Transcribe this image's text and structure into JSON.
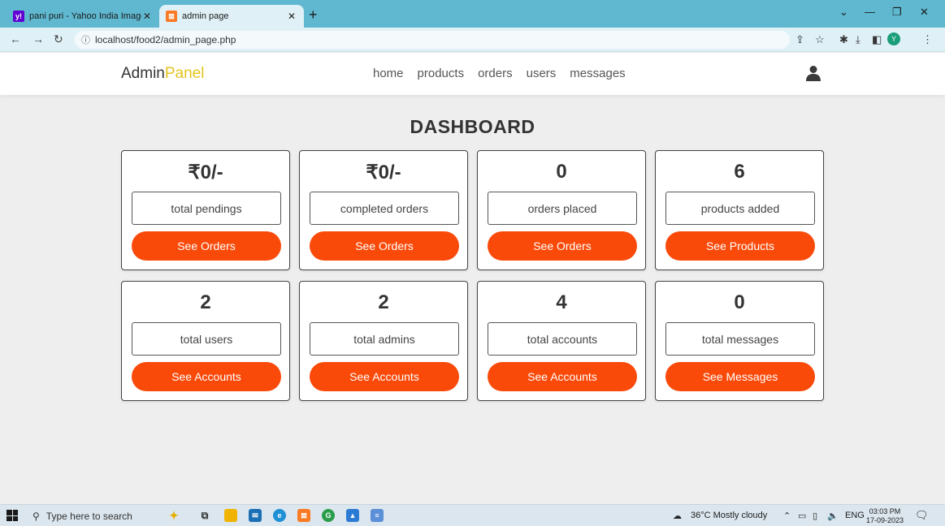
{
  "browser": {
    "tabs": [
      {
        "title": "pani puri - Yahoo India Image Se",
        "favicon": "yahoo-icon",
        "active": false
      },
      {
        "title": "admin page",
        "favicon": "xampp-icon",
        "active": true
      }
    ],
    "url": "localhost/food2/admin_page.php",
    "profile_initial": "Y"
  },
  "header": {
    "logo_main": "Admin",
    "logo_accent": "Panel",
    "nav": [
      "home",
      "products",
      "orders",
      "users",
      "messages"
    ],
    "user_icon": "user-icon"
  },
  "dashboard": {
    "title": "DASHBOARD",
    "cards": [
      {
        "value": "₹0/-",
        "label": "total pendings",
        "button": "See Orders"
      },
      {
        "value": "₹0/-",
        "label": "completed orders",
        "button": "See Orders"
      },
      {
        "value": "0",
        "label": "orders placed",
        "button": "See Orders"
      },
      {
        "value": "6",
        "label": "products added",
        "button": "See Products"
      },
      {
        "value": "2",
        "label": "total users",
        "button": "See Accounts"
      },
      {
        "value": "2",
        "label": "total admins",
        "button": "See Accounts"
      },
      {
        "value": "4",
        "label": "total accounts",
        "button": "See Accounts"
      },
      {
        "value": "0",
        "label": "total messages",
        "button": "See Messages"
      }
    ]
  },
  "taskbar": {
    "search_placeholder": "Type here to search",
    "weather": "36°C  Mostly cloudy",
    "lang": "ENG",
    "time": "03:03 PM",
    "date": "17-09-2023"
  },
  "colors": {
    "accent_button": "#fa4a0a",
    "logo_accent": "#e3c41e",
    "tab_strip": "#5fb8d0"
  }
}
